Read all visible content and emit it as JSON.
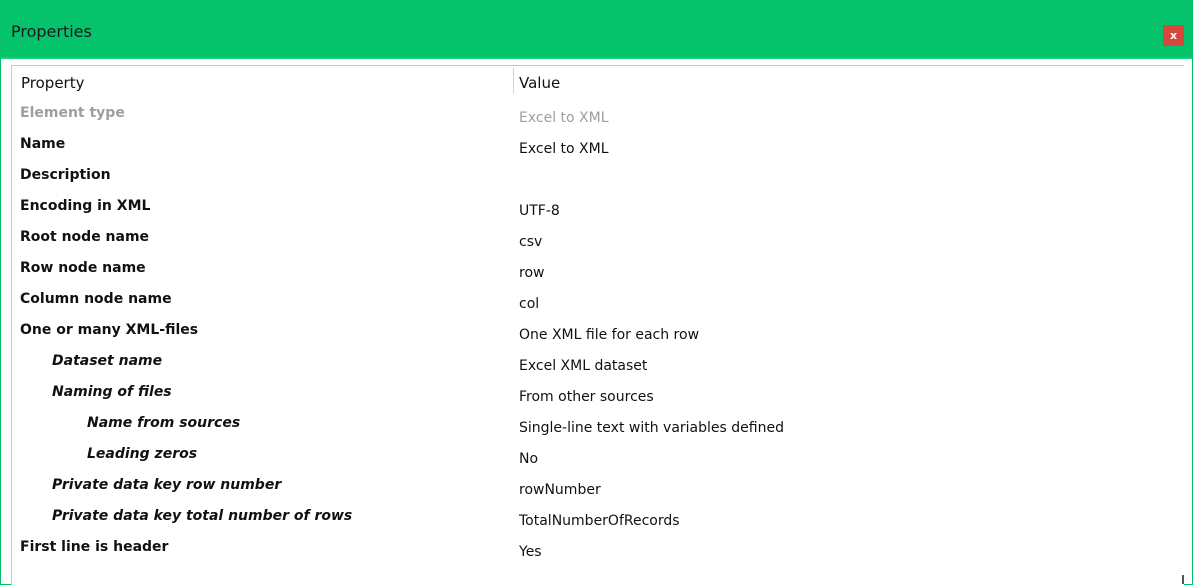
{
  "window": {
    "title": "Properties",
    "close_label": "x"
  },
  "table": {
    "headers": {
      "property": "Property",
      "value": "Value"
    },
    "rows": [
      {
        "name": "Element type",
        "value": "Excel to XML",
        "level": 0,
        "disabled": true
      },
      {
        "name": "Name",
        "value": "Excel to XML",
        "level": 0
      },
      {
        "name": "Description",
        "value": "",
        "level": 0
      },
      {
        "name": "Encoding in XML",
        "value": "UTF-8",
        "level": 0
      },
      {
        "name": "Root node name",
        "value": "csv",
        "level": 0
      },
      {
        "name": "Row node name",
        "value": "row",
        "level": 0
      },
      {
        "name": "Column node name",
        "value": "col",
        "level": 0
      },
      {
        "name": "One or many XML-files",
        "value": "One XML file for each row",
        "level": 0
      },
      {
        "name": "Dataset name",
        "value": "Excel XML dataset",
        "level": 1
      },
      {
        "name": "Naming of files",
        "value": "From other sources",
        "level": 1
      },
      {
        "name": "Name from sources",
        "value": "Single-line text with variables defined",
        "level": 2
      },
      {
        "name": "Leading zeros",
        "value": "No",
        "level": 2
      },
      {
        "name": "Private data key row number",
        "value": "rowNumber",
        "level": 1
      },
      {
        "name": "Private data key total number of rows",
        "value": "TotalNumberOfRecords",
        "level": 1
      },
      {
        "name": "First line is header",
        "value": "Yes",
        "level": 0
      }
    ]
  },
  "colors": {
    "titlebar": "#04c36a",
    "close": "#d9473c",
    "disabled_text": "#9e9e9e"
  },
  "icons": {
    "close": "close-icon"
  }
}
